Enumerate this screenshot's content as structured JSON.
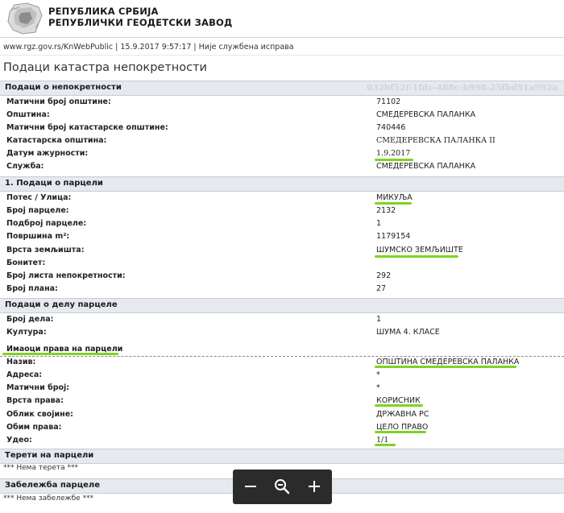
{
  "header": {
    "org_line1": "РЕПУБЛИКА СРБИЈА",
    "org_line2": "РЕПУБЛИЧКИ ГЕОДЕТСКИ ЗАВОД",
    "logo_icon": "serbia-map-logo-icon"
  },
  "meta": {
    "url": "www.rgz.gov.rs/KnWebPublic",
    "datetime": "15.9.2017 9:57:17",
    "note": "Није службена исправа"
  },
  "page_title": "Подаци катастра непокретности",
  "property": {
    "title": "Подаци о непокретности",
    "guid": "032bf52f-1fdc-488c-b998-25fbd91a992a",
    "rows": [
      {
        "label": "Матични број општине:",
        "value": "71102"
      },
      {
        "label": "Општина:",
        "value": "СМЕДЕРЕВСКА ПАЛАНКА"
      },
      {
        "label": "Матични број катастарске општине:",
        "value": "740446"
      },
      {
        "label": "Катастарска општина:",
        "value": "СМЕДЕРЕВСКА ПАЛАНКА II"
      },
      {
        "label": "Датум ажурности:",
        "value": "1.9.2017"
      },
      {
        "label": "Служба:",
        "value": "СМЕДЕРЕВСКА ПАЛАНКА"
      }
    ]
  },
  "parcel": {
    "title": "1. Подаци о парцели",
    "rows": [
      {
        "label": "Потес / Улица:",
        "value": "МИКУЉА"
      },
      {
        "label": "Број парцеле:",
        "value": "2132"
      },
      {
        "label": "Подброј парцеле:",
        "value": "1"
      },
      {
        "label": "Површина m²:",
        "value": "1179154"
      },
      {
        "label": "Врста земљишта:",
        "value": "ШУМСКО ЗЕМЉИШТЕ"
      },
      {
        "label": "Бонитет:",
        "value": ""
      },
      {
        "label": "Број листа непокретности:",
        "value": "292"
      },
      {
        "label": "Број плана:",
        "value": "27"
      }
    ]
  },
  "parcel_part": {
    "title": "Подаци о делу парцеле",
    "rows": [
      {
        "label": "Број дела:",
        "value": "1"
      },
      {
        "label": "Култура:",
        "value": "ШУМА 4. КЛАСЕ"
      }
    ]
  },
  "owners": {
    "title": "Имаоци права на парцели",
    "rows": [
      {
        "label": "Назив:",
        "value": "ОПШТИНА СМЕДЕРЕВСКА ПАЛАНКА"
      },
      {
        "label": "Адреса:",
        "value": "*"
      },
      {
        "label": "Матични број:",
        "value": "*"
      },
      {
        "label": "Врста права:",
        "value": "КОРИСНИК"
      },
      {
        "label": "Облик својине:",
        "value": "ДРЖАВНА РС"
      },
      {
        "label": "Обим права:",
        "value": "ЦЕЛО ПРАВО"
      },
      {
        "label": "Удео:",
        "value": "1/1"
      }
    ]
  },
  "burdens": {
    "title": "Терети на парцели",
    "text": "*** Нема терета ***"
  },
  "notes": {
    "title": "Забележба парцеле",
    "text": "*** Нема забележбе ***"
  },
  "zoom_toolbar": {
    "zoom_out_icon": "minus-icon",
    "zoom_reset_icon": "magnifier-minus-icon",
    "zoom_in_icon": "plus-icon"
  },
  "highlight_color": "#7ed321"
}
